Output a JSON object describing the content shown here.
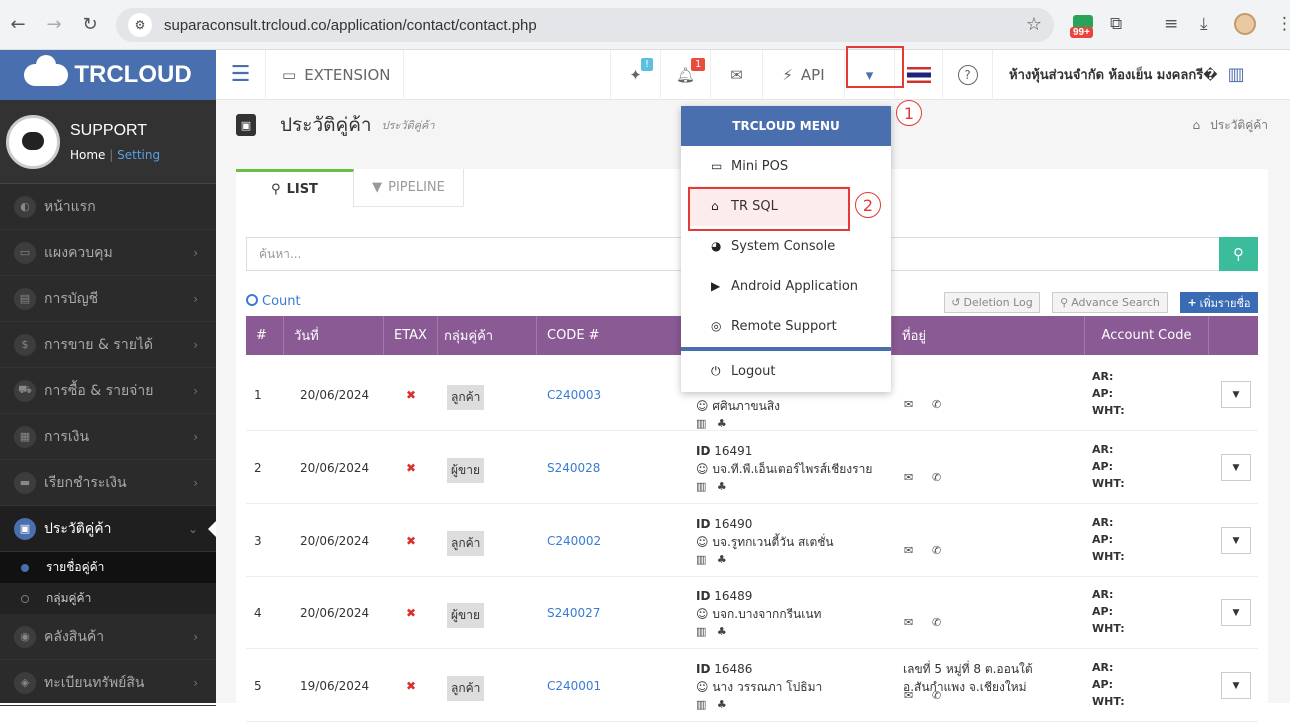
{
  "browser": {
    "url": "suparaconsult.trcloud.co/application/contact/contact.php",
    "ext_badge": "99+"
  },
  "logo": {
    "text": "TRCLOUD"
  },
  "user": {
    "name": "SUPPORT",
    "home": "Home",
    "sep": "|",
    "setting": "Setting"
  },
  "sidebar": {
    "items": [
      {
        "label": "หน้าแรก",
        "icon": "◐"
      },
      {
        "label": "แผงควบคุม",
        "icon": "▭"
      },
      {
        "label": "การบัญชี",
        "icon": "▤"
      },
      {
        "label": "การขาย & รายได้",
        "icon": "$"
      },
      {
        "label": "การซื้อ & รายจ่าย",
        "icon": "⛟"
      },
      {
        "label": "การเงิน",
        "icon": "▦"
      },
      {
        "label": "เรียกชำระเงิน",
        "icon": "▬"
      },
      {
        "label": "ประวัติคู่ค้า",
        "icon": "▣"
      },
      {
        "label": "คลังสินค้า",
        "icon": "◉"
      },
      {
        "label": "ทะเบียนทรัพย์สิน",
        "icon": "◈"
      }
    ],
    "subitems": [
      {
        "label": "รายชื่อคู่ค้า"
      },
      {
        "label": "กลุ่มคู่ค้า"
      }
    ]
  },
  "topbar": {
    "menu_icon": "☰",
    "extension": "EXTENSION",
    "notif_badge_1": "!",
    "notif_badge_2": "1",
    "api": "API",
    "company": "ห้างหุ้นส่วนจำกัด ห้องเย็น มงคลกรี�"
  },
  "page": {
    "title": "ประวัติคู่ค้า",
    "subtitle": "ประวัติคู่ค้า",
    "breadcrumb": "ประวัติคู่ค้า"
  },
  "tabs": {
    "list": "LIST",
    "pipeline": "PIPELINE"
  },
  "search": {
    "placeholder": "ค้นหา..."
  },
  "toolbar": {
    "count": "Count",
    "deletion_log": "Deletion Log",
    "advance_search": "Advance Search",
    "add": "เพิ่มรายชื่อ"
  },
  "table": {
    "headers": [
      "#",
      "วันที่",
      "ETAX",
      "กลุ่มคู่ค้า",
      "CODE #",
      "ที่อยู่",
      "Account Code"
    ],
    "acc_labels": [
      "AR:",
      "AP:",
      "WHT:"
    ],
    "rows": [
      {
        "no": "1",
        "date": "20/06/2024",
        "group": "ลูกค้า",
        "code": "C240003",
        "id_label": "ID",
        "id": "",
        "name": "ศศินภาขนสิง",
        "addr1": "",
        "addr2": ""
      },
      {
        "no": "2",
        "date": "20/06/2024",
        "group": "ผู้ขาย",
        "code": "S240028",
        "id_label": "ID",
        "id": "16491",
        "name": "บจ.ที.พี.เอ็นเตอร์ไพรส์เชียงราย",
        "addr1": "",
        "addr2": ""
      },
      {
        "no": "3",
        "date": "20/06/2024",
        "group": "ลูกค้า",
        "code": "C240002",
        "id_label": "ID",
        "id": "16490",
        "name": "บจ.รูทกเวนตี้วัน สเตชั่น",
        "addr1": "",
        "addr2": ""
      },
      {
        "no": "4",
        "date": "20/06/2024",
        "group": "ผู้ขาย",
        "code": "S240027",
        "id_label": "ID",
        "id": "16489",
        "name": "บจก.บางจากกรีนเนท",
        "addr1": "",
        "addr2": ""
      },
      {
        "no": "5",
        "date": "19/06/2024",
        "group": "ลูกค้า",
        "code": "C240001",
        "id_label": "ID",
        "id": "16486",
        "name": "นาง วรรณภา โปธิมา",
        "addr1": "เลขที่ 5 หมู่ที่ 8 ต.ออนใต้",
        "addr2": "อ.สันกำแพง จ.เชียงใหม่"
      }
    ]
  },
  "dropdown": {
    "header": "TRCLOUD MENU",
    "items": [
      {
        "label": "Mini POS",
        "icon": "▭"
      },
      {
        "label": "TR SQL",
        "icon": "⌂"
      },
      {
        "label": "System Console",
        "icon": "◕"
      },
      {
        "label": "Android Application",
        "icon": "▶"
      },
      {
        "label": "Remote Support",
        "icon": "◎"
      },
      {
        "label": "Logout",
        "icon": "⏻"
      }
    ]
  },
  "annotations": {
    "one": "1",
    "two": "2"
  },
  "colors": {
    "brand": "#4a6fae",
    "table_header": "#8a5a94",
    "search_btn": "#3bbc9b",
    "highlight": "#e53935"
  }
}
